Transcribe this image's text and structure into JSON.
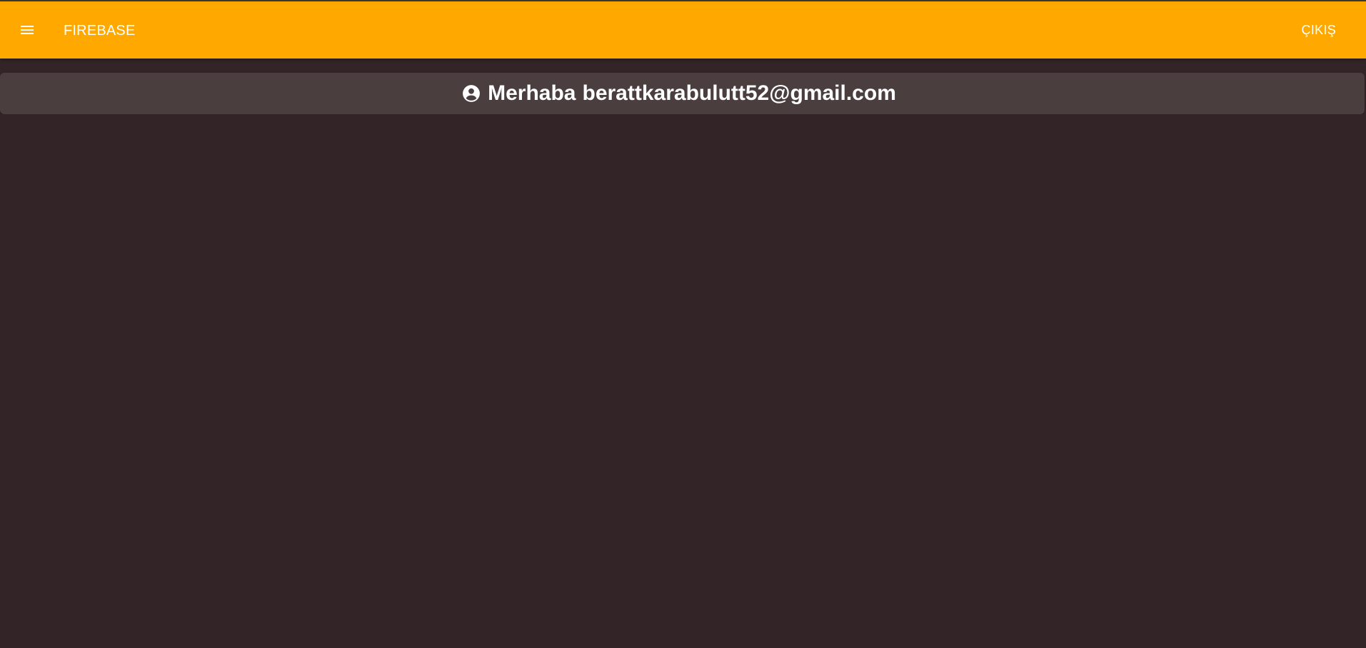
{
  "app_bar": {
    "title": "FIREBASE",
    "logout_label": "ÇIKIŞ",
    "menu_icon": "menu-icon",
    "background_color": "#ffa800"
  },
  "greeting": {
    "prefix": "Merhaba",
    "email": "berattkarabulutt52@gmail.com",
    "icon": "account-circle-icon",
    "card_color": "#4a3e3f"
  },
  "theme": {
    "page_background": "#332527",
    "text_color": "#ffffff"
  }
}
